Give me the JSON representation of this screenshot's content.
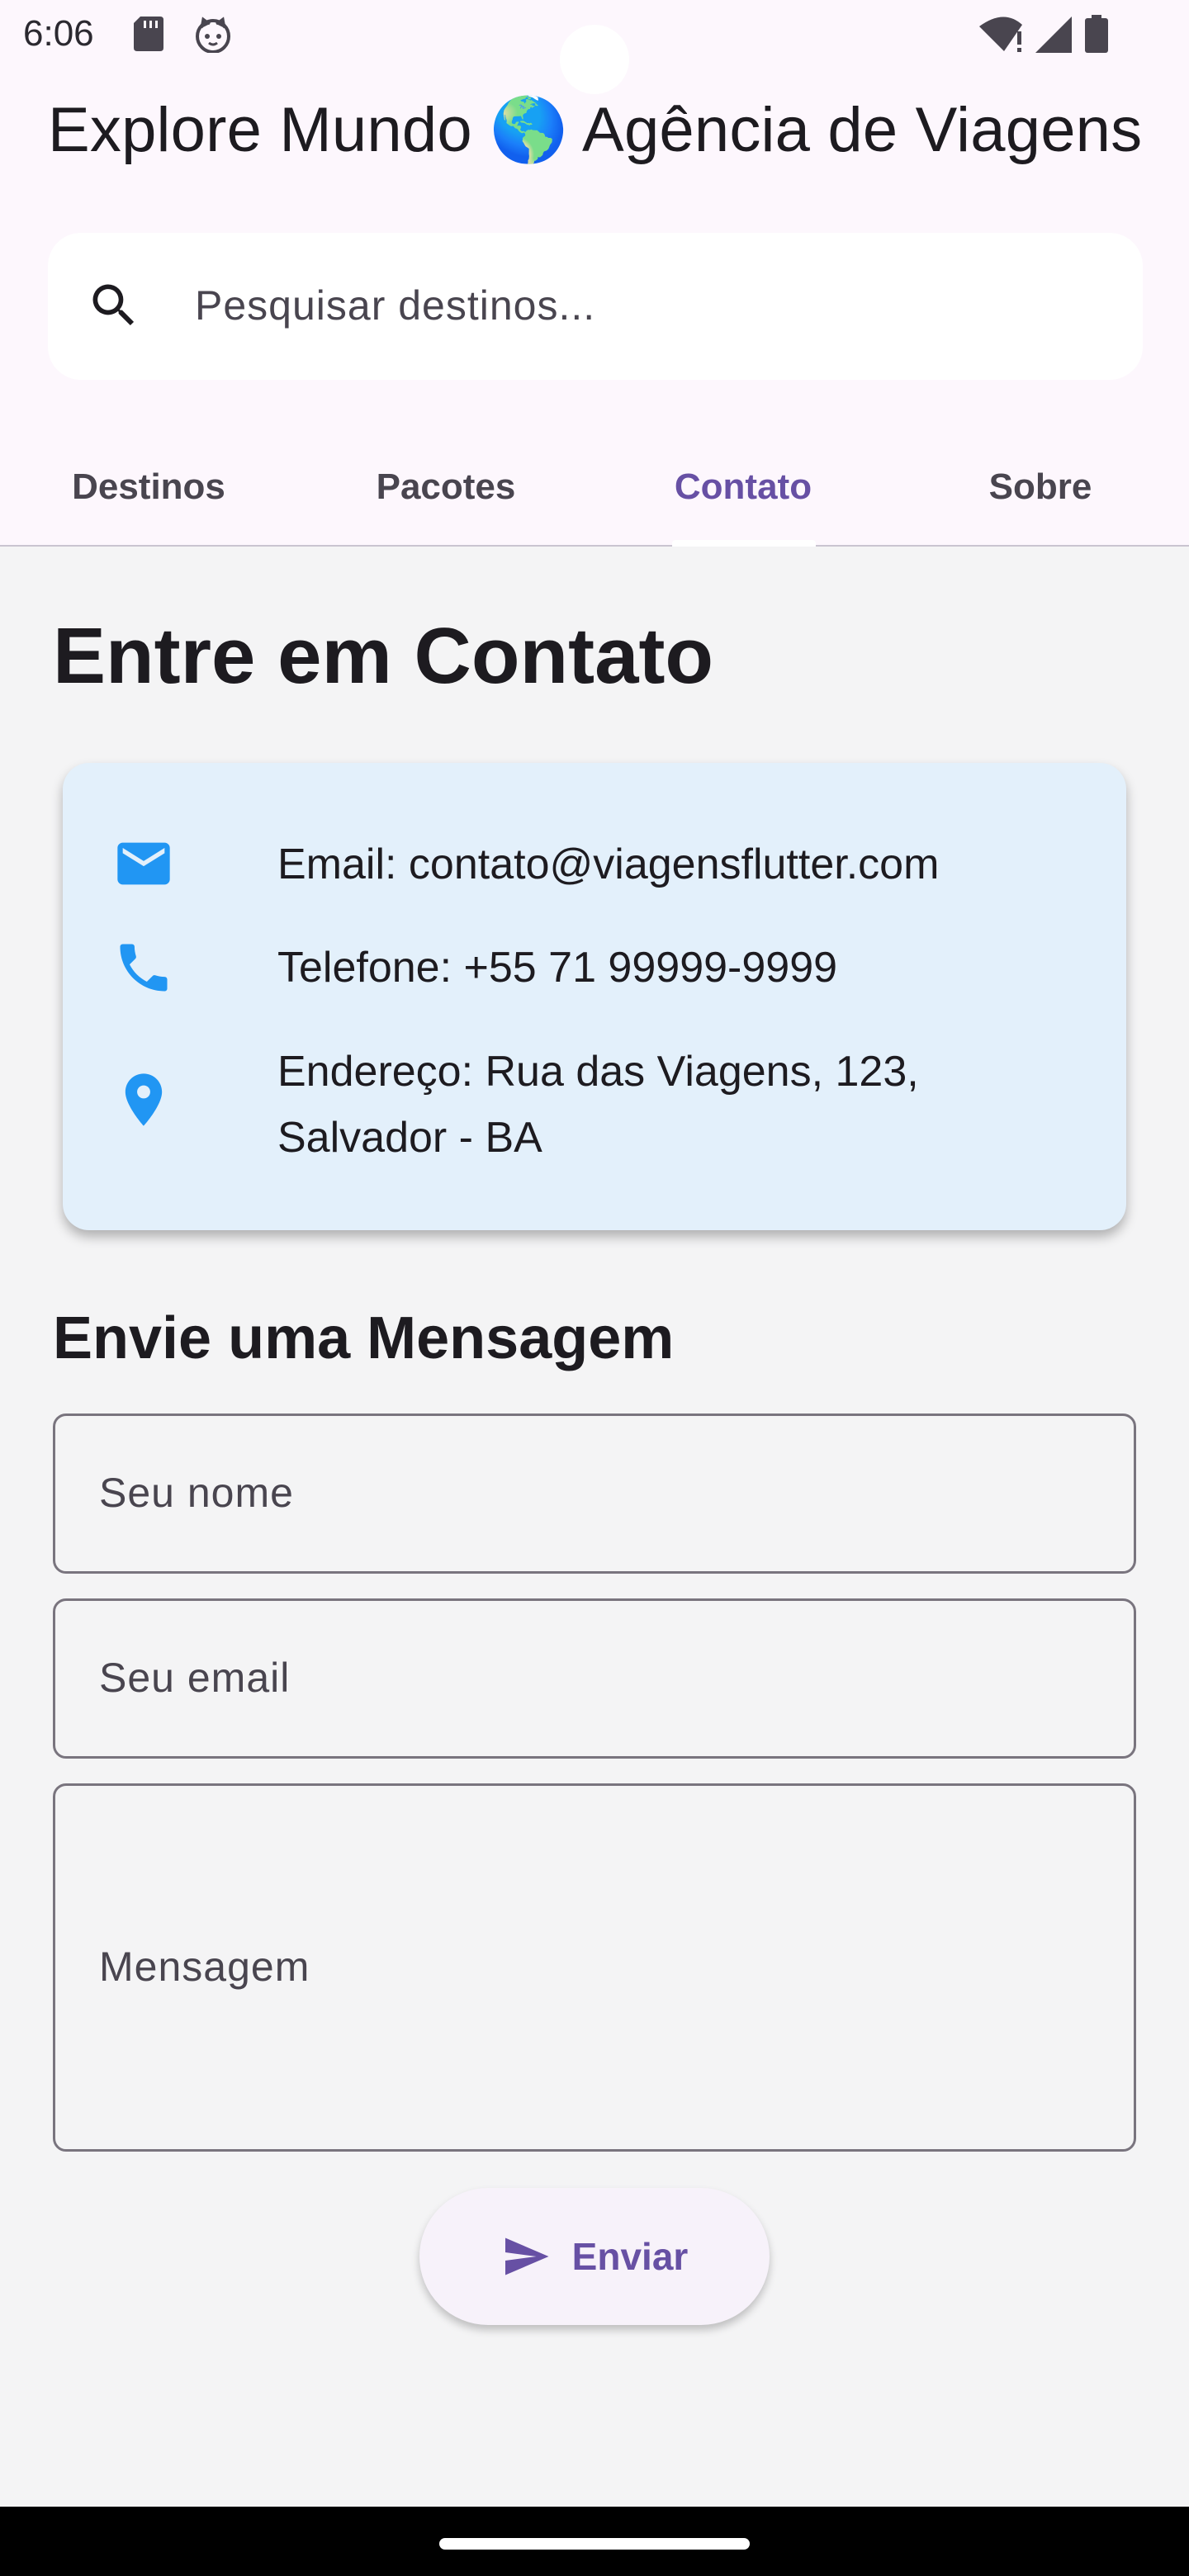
{
  "status_bar": {
    "time": "6:06",
    "icons": [
      "sd-card-icon",
      "cat-icon",
      "wifi-alert-icon",
      "signal-icon",
      "battery-icon"
    ]
  },
  "app_bar": {
    "title": "Explore Mundo 🌎 Agência de Viagens"
  },
  "search": {
    "placeholder": "Pesquisar destinos...",
    "value": "",
    "icon": "search-icon"
  },
  "tabs": [
    {
      "label": "Destinos",
      "active": false
    },
    {
      "label": "Pacotes",
      "active": false
    },
    {
      "label": "Contato",
      "active": true
    },
    {
      "label": "Sobre",
      "active": false
    }
  ],
  "contact": {
    "title": "Entre em Contato",
    "items": [
      {
        "icon": "mail-icon",
        "line1": "Email: contato@viagensflutter.com"
      },
      {
        "icon": "phone-icon",
        "line1": "Telefone: +55 71 99999-9999"
      },
      {
        "icon": "location-pin-icon",
        "line1": "Endereço: Rua das Viagens, 123,",
        "line2": "Salvador - BA"
      }
    ]
  },
  "form": {
    "title": "Envie uma Mensagem",
    "name_placeholder": "Seu nome",
    "email_placeholder": "Seu email",
    "message_placeholder": "Mensagem",
    "send_label": "Enviar"
  },
  "colors": {
    "accent": "#6750a4",
    "icon_blue": "#2196f3",
    "card_background": "#e3f0fb",
    "header_background": "#fdf7fd",
    "page_background": "#f4f4f5"
  }
}
